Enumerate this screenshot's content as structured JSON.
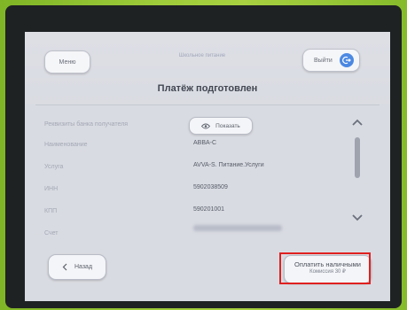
{
  "header": {
    "menu_label": "Меню",
    "hint": "Школьное питание",
    "exit_label": "Выйти"
  },
  "page_title": "Платёж подготовлен",
  "details": {
    "bank_requisites_label": "Реквизиты банка получателя",
    "show_label": "Показать",
    "rows": [
      {
        "label": "Наименование",
        "value": "ABBA-C"
      },
      {
        "label": "Услуга",
        "value": "AVVA-S. Питание.Услуги"
      },
      {
        "label": "ИНН",
        "value": "5902038509"
      },
      {
        "label": "КПП",
        "value": "590201001"
      },
      {
        "label": "Счет",
        "value": ""
      }
    ]
  },
  "footer": {
    "back_label": "Назад",
    "pay_label": "Оплатить наличными",
    "commission": "Комиссия 30 ₽"
  },
  "colors": {
    "frame_green": "#9fcc3a",
    "screen_bg": "#d9dbe2",
    "accent_blue": "#3d7fe0",
    "highlight_red": "#e02020"
  }
}
